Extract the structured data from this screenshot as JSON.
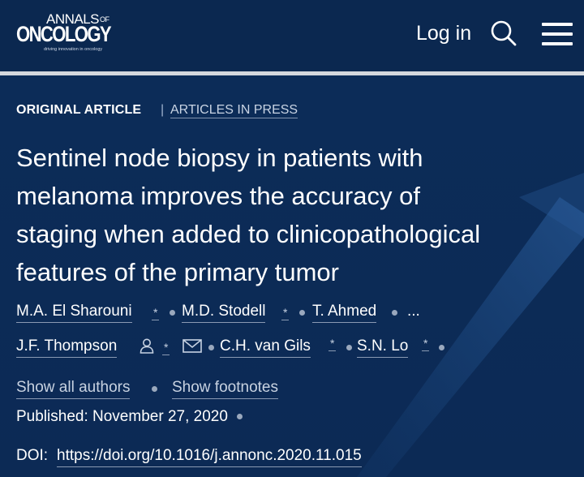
{
  "header": {
    "logo_top": "ANNALS",
    "logo_of": "OF",
    "logo_main": "ONCOLOGY",
    "logo_tagline": "driving innovation in oncology",
    "login_label": "Log in",
    "search_icon": "search-icon",
    "menu_icon": "hamburger-menu-icon"
  },
  "article": {
    "type": "ORIGINAL ARTICLE",
    "separator": "|",
    "status": "ARTICLES IN PRESS",
    "title_lines": [
      "Sentinel node biopsy in patients with",
      "melanoma improves the accuracy of",
      "staging when added to clinicopathological",
      "features of the primary tumor"
    ],
    "authors_row1": [
      "M.A. El Sharouni",
      "M.D. Stodell",
      "T. Ahmed"
    ],
    "ellipsis": "...",
    "authors_row2": [
      "J.F. Thompson",
      "C.H. van Gils",
      "S.N. Lo"
    ],
    "footnote_mark": "*",
    "show_authors": "Show all authors",
    "show_footnotes": "Show footnotes",
    "published_label": "Published:",
    "published_date": "November 27, 2020",
    "doi_label": "DOI:",
    "doi_url": "https://doi.org/10.1016/j.annonc.2020.11.015"
  },
  "colors": {
    "background": "#0c2a55",
    "header": "#0b2850",
    "divider": "#d4d8dd",
    "link_muted": "#c8d2e1",
    "dot": "#9aa8bd"
  }
}
